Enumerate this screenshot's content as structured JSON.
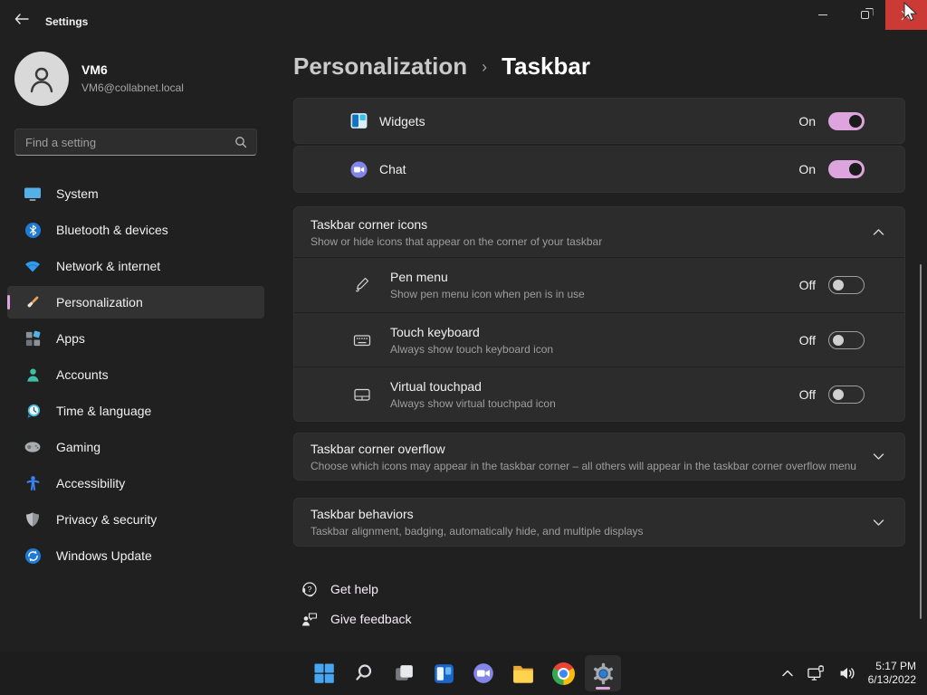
{
  "window": {
    "title": "Settings",
    "controls": {
      "minimize": "minimize",
      "maximize": "restore",
      "close": "close",
      "close_hover_color": "#cb3a35"
    }
  },
  "sidebar": {
    "user": {
      "name": "VM6",
      "email": "VM6@collabnet.local"
    },
    "search": {
      "placeholder": "Find a setting",
      "icon": "search-icon"
    },
    "items": [
      {
        "label": "System",
        "icon": "system-icon",
        "selected": false
      },
      {
        "label": "Bluetooth & devices",
        "icon": "bluetooth-icon",
        "selected": false
      },
      {
        "label": "Network & internet",
        "icon": "network-icon",
        "selected": false
      },
      {
        "label": "Personalization",
        "icon": "personalization-icon",
        "selected": true
      },
      {
        "label": "Apps",
        "icon": "apps-icon",
        "selected": false
      },
      {
        "label": "Accounts",
        "icon": "accounts-icon",
        "selected": false
      },
      {
        "label": "Time & language",
        "icon": "time-icon",
        "selected": false
      },
      {
        "label": "Gaming",
        "icon": "gaming-icon",
        "selected": false
      },
      {
        "label": "Accessibility",
        "icon": "accessibility-icon",
        "selected": false
      },
      {
        "label": "Privacy & security",
        "icon": "privacy-icon",
        "selected": false
      },
      {
        "label": "Windows Update",
        "icon": "windows-update-icon",
        "selected": false
      }
    ]
  },
  "breadcrumb": {
    "parent": "Personalization",
    "separator": "›",
    "current": "Taskbar"
  },
  "main": {
    "toggle_rows": [
      {
        "label": "Widgets",
        "icon": "widgets-icon",
        "state": "On"
      },
      {
        "label": "Chat",
        "icon": "chat-icon",
        "state": "On"
      }
    ],
    "corner_icons": {
      "title": "Taskbar corner icons",
      "description": "Show or hide icons that appear on the corner of your taskbar",
      "expanded": true,
      "rows": [
        {
          "label": "Pen menu",
          "description": "Show pen menu icon when pen is in use",
          "icon": "pen-icon",
          "state": "Off"
        },
        {
          "label": "Touch keyboard",
          "description": "Always show touch keyboard icon",
          "icon": "touch-keyboard-icon",
          "state": "Off"
        },
        {
          "label": "Virtual touchpad",
          "description": "Always show virtual touchpad icon",
          "icon": "virtual-touchpad-icon",
          "state": "Off"
        }
      ]
    },
    "collapsed_sections": [
      {
        "title": "Taskbar corner overflow",
        "description": "Choose which icons may appear in the taskbar corner – all others will appear in the taskbar corner overflow menu",
        "expanded": false
      },
      {
        "title": "Taskbar behaviors",
        "description": "Taskbar alignment, badging, automatically hide, and multiple displays",
        "expanded": false
      }
    ],
    "footer_links": [
      {
        "label": "Get help",
        "icon": "get-help-icon"
      },
      {
        "label": "Give feedback",
        "icon": "give-feedback-icon"
      }
    ]
  },
  "taskbar": {
    "items": [
      "start",
      "search",
      "task-view",
      "widgets",
      "chat",
      "file-explorer",
      "chrome",
      "settings"
    ],
    "active_item": "settings",
    "tray": {
      "hidden_icons": "chevron-up",
      "network": "ethernet-icon",
      "volume": "speaker-icon",
      "time": "5:17 PM",
      "date": "6/13/2022"
    }
  },
  "colors": {
    "accent": "#dda4dd",
    "background": "#202020",
    "card": "#2c2c2c",
    "close_red": "#cb3a35"
  }
}
